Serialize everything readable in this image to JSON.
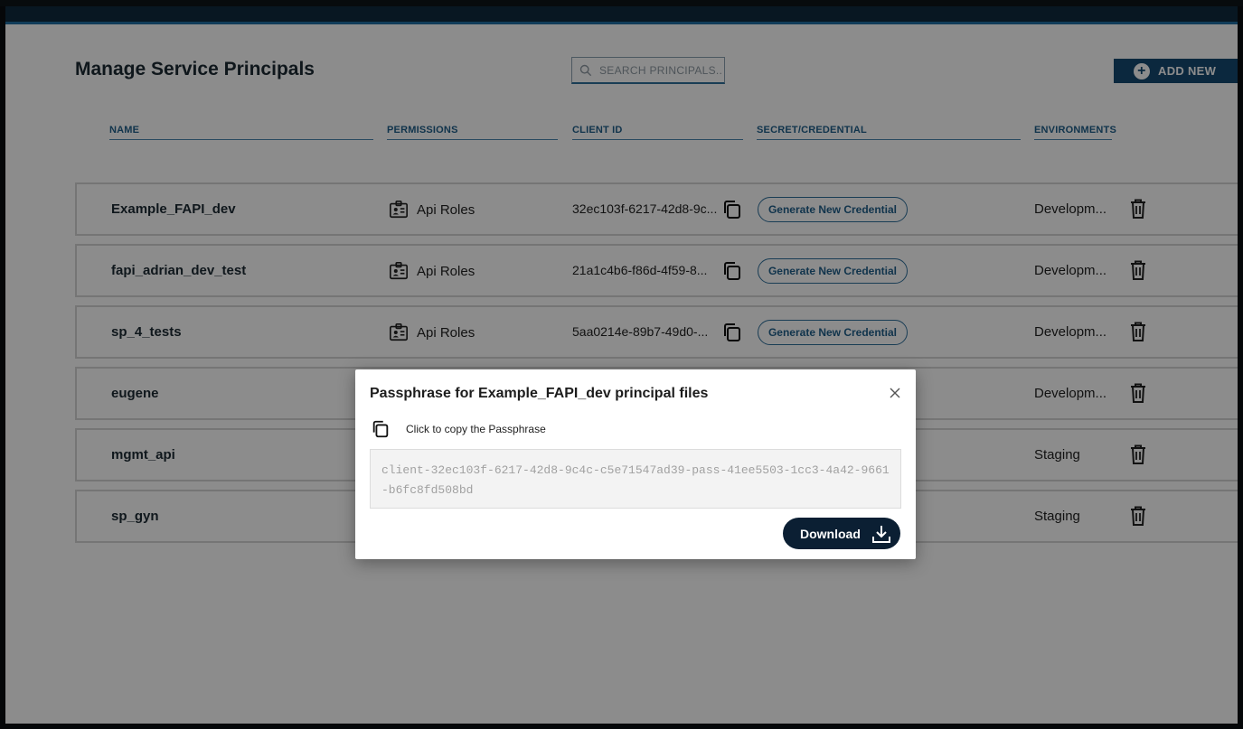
{
  "page": {
    "title": "Manage Service Principals",
    "search_placeholder": "SEARCH PRINCIPALS...",
    "add_new_label": "ADD NEW"
  },
  "columns": {
    "name": "NAME",
    "permissions": "PERMISSIONS",
    "client_id": "CLIENT ID",
    "secret": "SECRET/CREDENTIAL",
    "environments": "ENVIRONMENTS"
  },
  "rows": [
    {
      "name": "Example_FAPI_dev",
      "permissions": "Api Roles",
      "client_id": "32ec103f-6217-42d8-9c...",
      "credential": "Generate New Credential",
      "environment": "Developm..."
    },
    {
      "name": "fapi_adrian_dev_test",
      "permissions": "Api Roles",
      "client_id": "21a1c4b6-f86d-4f59-8...",
      "credential": "Generate New Credential",
      "environment": "Developm..."
    },
    {
      "name": "sp_4_tests",
      "permissions": "Api Roles",
      "client_id": "5aa0214e-89b7-49d0-...",
      "credential": "Generate New Credential",
      "environment": "Developm..."
    },
    {
      "name": "eugene",
      "environment": "Developm..."
    },
    {
      "name": "mgmt_api",
      "environment": "Staging"
    },
    {
      "name": "sp_gyn",
      "environment": "Staging"
    }
  ],
  "modal": {
    "title": "Passphrase for Example_FAPI_dev principal files",
    "copy_label": "Click to copy the Passphrase",
    "passphrase": "client-32ec103f-6217-42d8-9c4c-c5e71547ad39-pass-41ee5503-1cc3-4a42-9661-b6fc8fd508bd",
    "download_label": "Download"
  },
  "colors": {
    "accent": "#1f5f8b",
    "header_bar": "#154a72",
    "download_button": "#0b1f33"
  }
}
